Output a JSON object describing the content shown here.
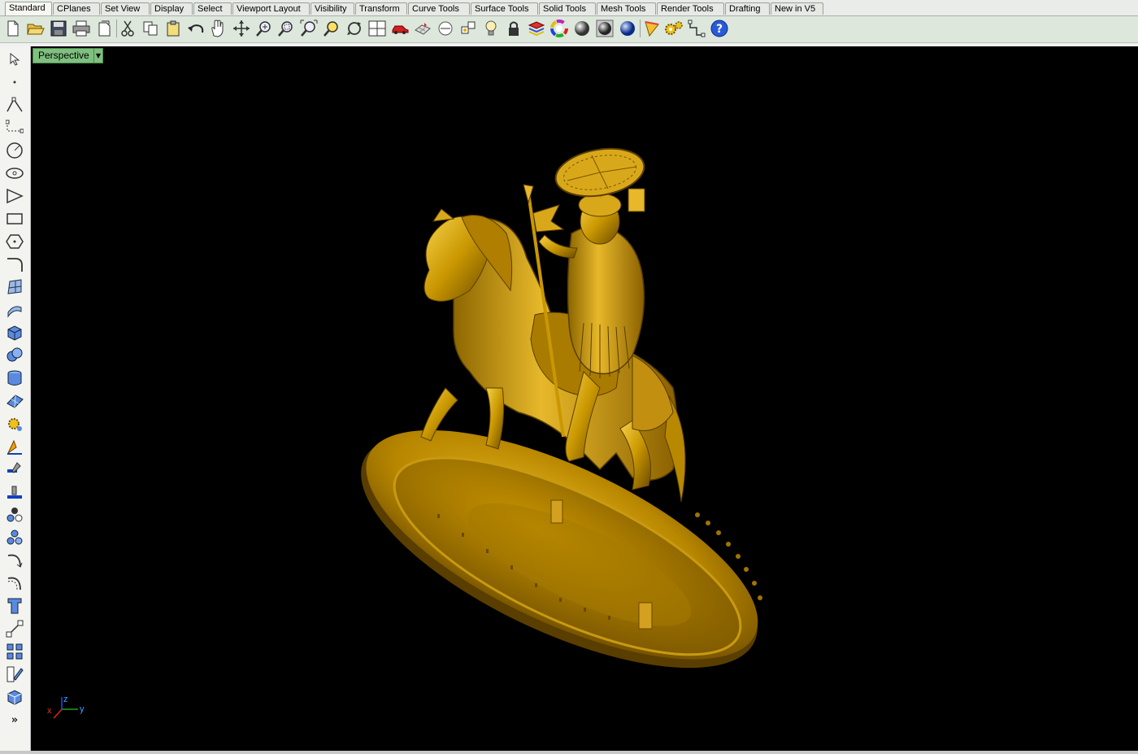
{
  "tabs": [
    {
      "label": "Standard",
      "active": true
    },
    {
      "label": "CPlanes"
    },
    {
      "label": "Set View"
    },
    {
      "label": "Display"
    },
    {
      "label": "Select"
    },
    {
      "label": "Viewport Layout"
    },
    {
      "label": "Visibility"
    },
    {
      "label": "Transform"
    },
    {
      "label": "Curve Tools"
    },
    {
      "label": "Surface Tools"
    },
    {
      "label": "Solid Tools"
    },
    {
      "label": "Mesh Tools"
    },
    {
      "label": "Render Tools"
    },
    {
      "label": "Drafting"
    },
    {
      "label": "New in V5"
    }
  ],
  "toolbar_icons": [
    "new-icon",
    "open-icon",
    "save-icon",
    "print-icon",
    "import-icon",
    "cut-icon",
    "copy-icon",
    "paste-icon",
    "undo-icon",
    "pan-hand-icon",
    "rotate-view-icon",
    "zoom-window-icon",
    "zoom-dynamic-icon",
    "zoom-extents-icon",
    "zoom-selected-icon",
    "rotate-icon",
    "viewport-layout-icon",
    "car-icon",
    "grid-snap-icon",
    "cplane-icon",
    "point-icon",
    "light-icon",
    "lock-icon",
    "layer-icon",
    "color-wheel-icon",
    "render-sphere-icon",
    "shaded-sphere-icon",
    "render-blue-sphere-icon",
    "material-icon",
    "options-gear-icon",
    "join-icon",
    "help-icon"
  ],
  "left_icons": [
    "select-arrow-icon",
    "point-icon",
    "polyline-icon",
    "curve-icon",
    "circle-icon",
    "ellipse-icon",
    "arc-icon",
    "rectangle-icon",
    "polygon-icon",
    "fillet-icon",
    "surface-icon",
    "extrude-icon",
    "box-icon",
    "boolean-icon",
    "cylinder-icon",
    "mesh-icon",
    "edit-points-icon",
    "flow-icon",
    "transform-icon",
    "project-icon",
    "group-icon",
    "cluster-icon",
    "curve-edit-icon",
    "blend-icon",
    "text-icon",
    "dimension-icon",
    "array-icon",
    "explode-icon",
    "solid-icon",
    "more-icon"
  ],
  "viewport": {
    "title": "Perspective",
    "axis_x": "x",
    "axis_y": "y",
    "axis_z": "z"
  },
  "colors": {
    "model_gold": "#c99700",
    "viewport_bg": "#000000",
    "toolbar_bg": "#dde7dc",
    "viewport_tab": "#7fbf7f"
  }
}
